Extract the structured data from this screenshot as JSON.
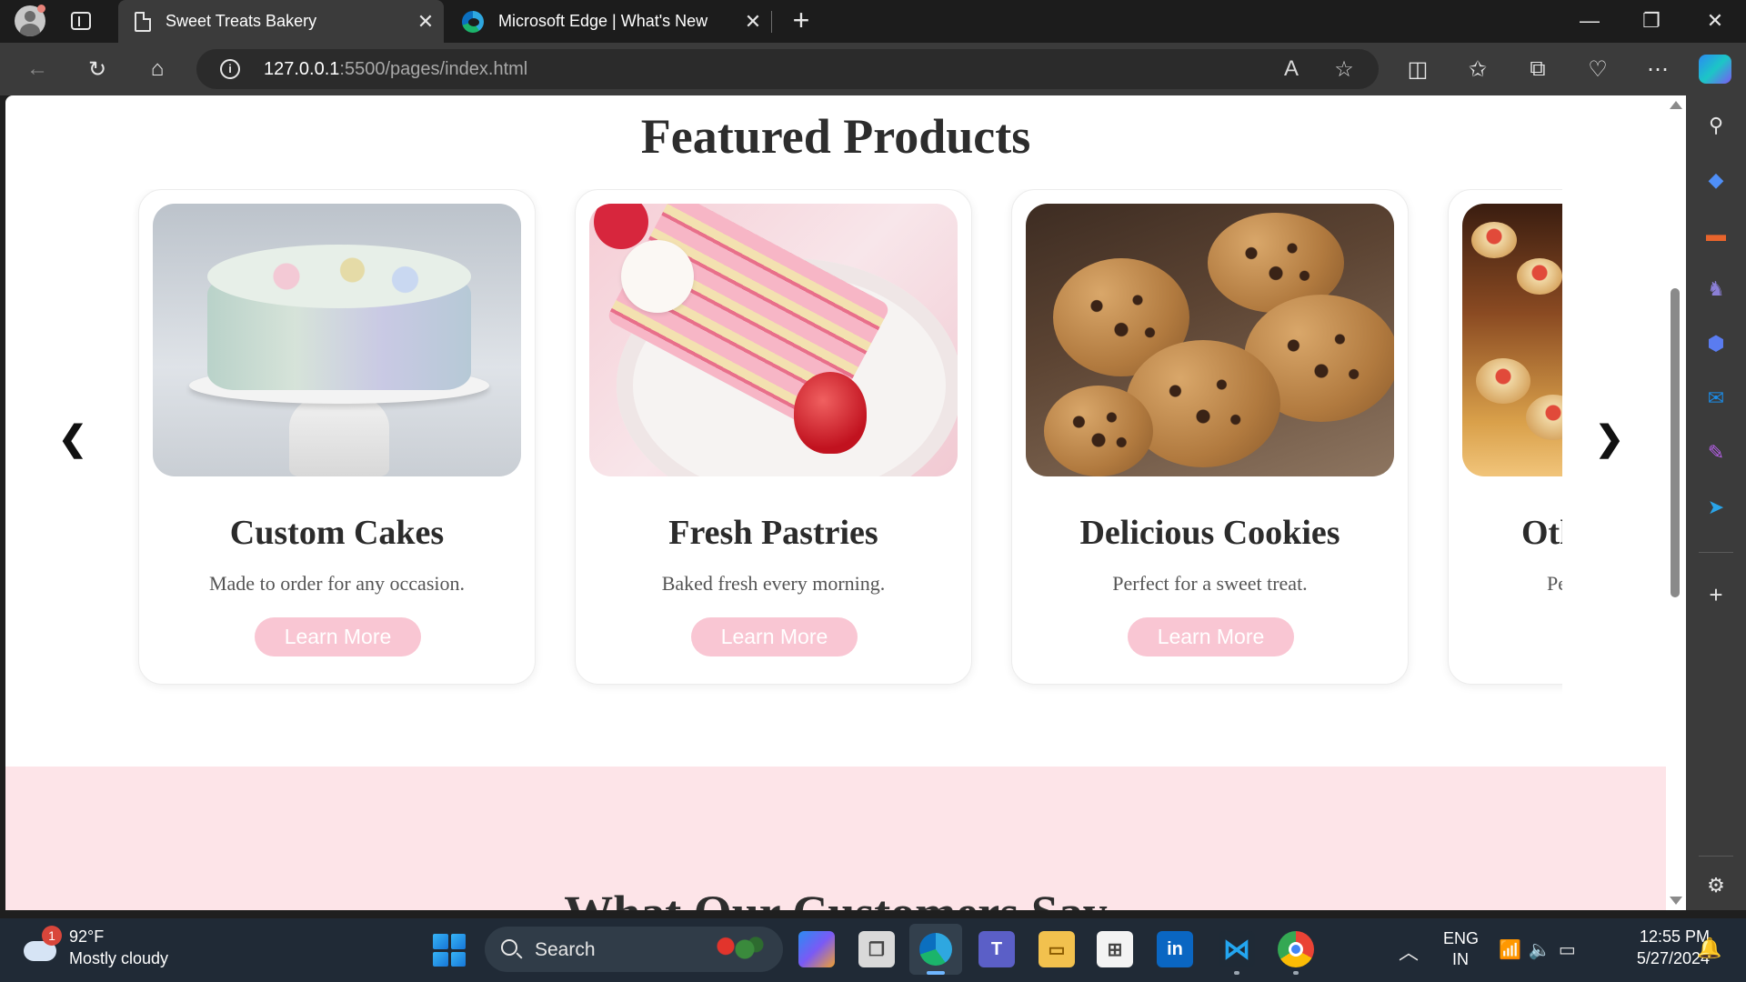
{
  "browser": {
    "tabs": [
      {
        "label": "Sweet Treats Bakery",
        "active": true
      },
      {
        "label": "Microsoft Edge | What's New",
        "active": false
      }
    ],
    "new_tab_label": "+",
    "url_host": "127.0.0.1",
    "url_path": ":5500/pages/index.html"
  },
  "page": {
    "featured_title": "Featured Products",
    "prev_arrow": "❮",
    "next_arrow": "❯",
    "products": [
      {
        "title": "Custom Cakes",
        "desc": "Made to order for any occasion.",
        "button": "Learn More"
      },
      {
        "title": "Fresh Pastries",
        "desc": "Baked fresh every morning.",
        "button": "Learn More"
      },
      {
        "title": "Delicious Cookies",
        "desc": "Perfect for a sweet treat.",
        "button": "Learn More"
      },
      {
        "title": "Otl",
        "desc": "Pe",
        "button": ""
      }
    ],
    "testimonials_title": "What Our Customers Say"
  },
  "taskbar": {
    "weather_badge": "1",
    "weather_temp": "92°F",
    "weather_desc": "Mostly cloudy",
    "search_label": "Search",
    "lang_line1": "ENG",
    "lang_line2": "IN",
    "time": "12:55 PM",
    "date": "5/27/2024"
  },
  "colors": {
    "accent_button": "#f9c6d3",
    "testimonials_bg": "#fde4e8"
  }
}
